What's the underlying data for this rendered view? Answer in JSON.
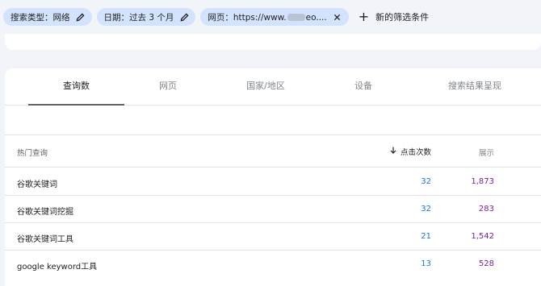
{
  "filters": [
    {
      "label": "搜索类型：网络",
      "icon": "pencil-icon"
    },
    {
      "label": "日期：过去 3 个月",
      "icon": "pencil-icon"
    },
    {
      "label_prefix": "网页：https://www.",
      "label_suffix": "eo....",
      "icon": "close-icon"
    }
  ],
  "add_filter": {
    "icon": "plus-icon",
    "label": "新的筛选条件"
  },
  "tabs": [
    {
      "label": "查询数",
      "active": true
    },
    {
      "label": "网页",
      "active": false
    },
    {
      "label": "国家/地区",
      "active": false
    },
    {
      "label": "设备",
      "active": false
    },
    {
      "label": "搜索结果呈现",
      "active": false
    }
  ],
  "table": {
    "headers": {
      "query": "热门查询",
      "clicks": "点击次数",
      "impressions": "展示",
      "sort_icon": "arrow-down-icon"
    },
    "rows": [
      {
        "query": "谷歌关键词",
        "clicks": "32",
        "impressions": "1,873"
      },
      {
        "query": "谷歌关键词挖掘",
        "clicks": "32",
        "impressions": "283"
      },
      {
        "query": "谷歌关键词工具",
        "clicks": "21",
        "impressions": "1,542"
      },
      {
        "query": "google keyword工具",
        "clicks": "13",
        "impressions": "528"
      }
    ]
  },
  "colors": {
    "chip_bg": "#d3e3fd",
    "clicks": "#1a73e8",
    "impressions": "#7b1fa2"
  }
}
